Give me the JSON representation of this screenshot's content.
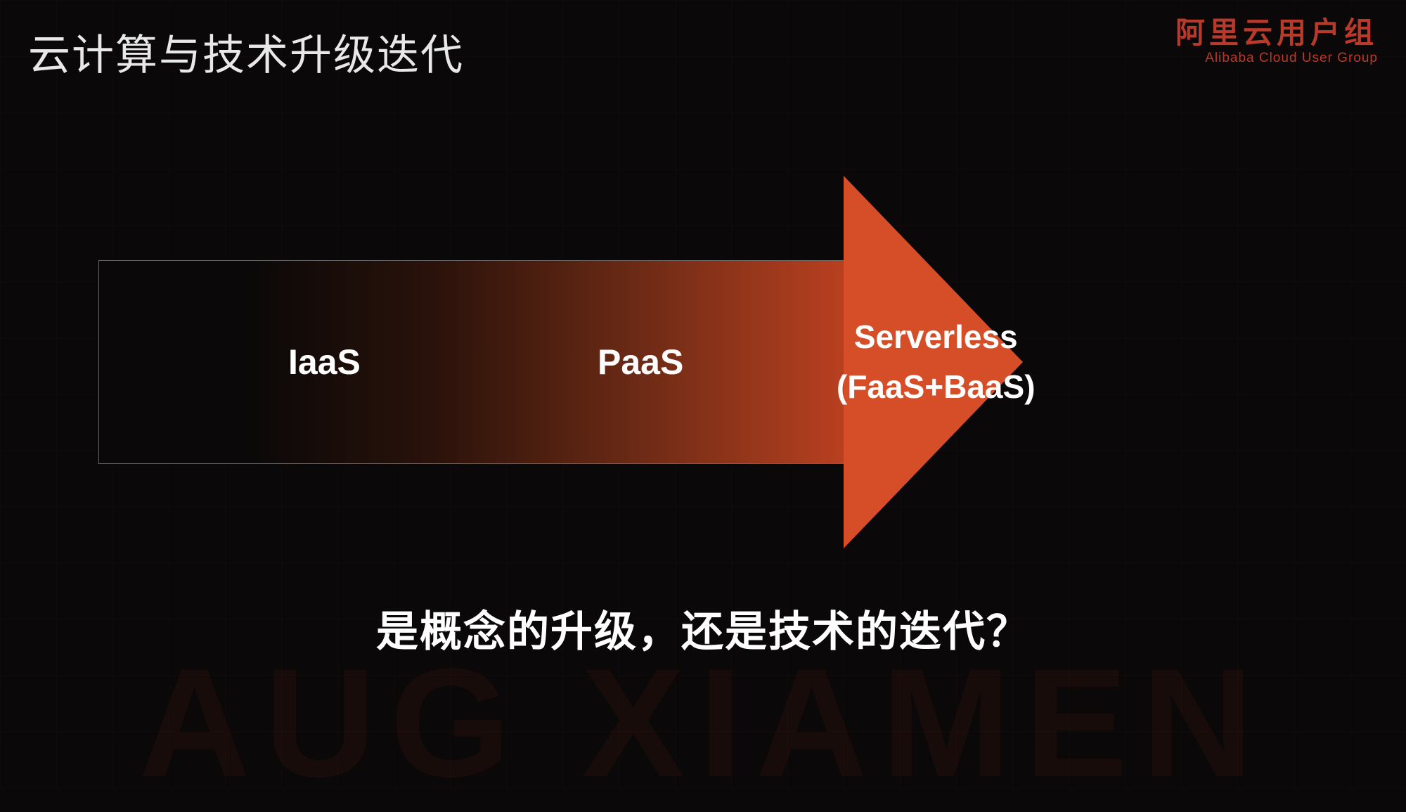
{
  "slide": {
    "title": "云计算与技术升级迭代",
    "logo_cn": "阿里云用户组",
    "logo_en": "Alibaba Cloud User Group",
    "watermark": "AUG XIAMEN",
    "question": "是概念的升级，还是技术的迭代？"
  },
  "arrow": {
    "stages": {
      "iaas": "IaaS",
      "paas": "PaaS",
      "serverless_line1": "Serverless",
      "serverless_line2": "(FaaS+BaaS)"
    }
  }
}
